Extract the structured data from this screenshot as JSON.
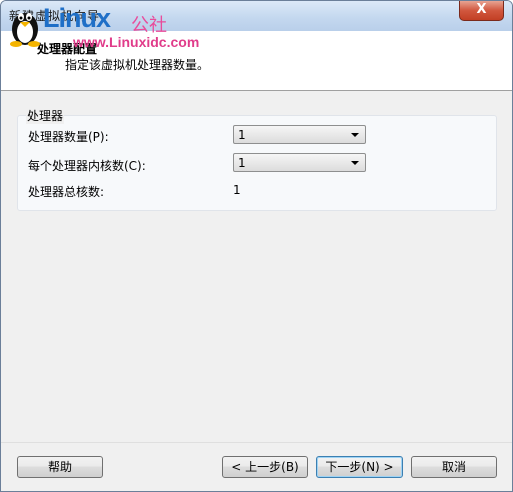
{
  "window": {
    "title": "新建虚拟机向导",
    "close_label": "X"
  },
  "watermark": {
    "brand": "Linux",
    "brand_cn": "公社",
    "url": "www.Linuxidc.com"
  },
  "header": {
    "title": "处理器配置",
    "description": "指定该虚拟机处理器数量。"
  },
  "processor_group": {
    "label": "处理器",
    "processor_count_label": "处理器数量(P):",
    "processor_count_value": "1",
    "cores_per_processor_label": "每个处理器内核数(C):",
    "cores_per_processor_value": "1",
    "total_cores_label": "处理器总核数:",
    "total_cores_value": "1"
  },
  "buttons": {
    "help": "帮助",
    "back": "< 上一步(B)",
    "next": "下一步(N) >",
    "cancel": "取消"
  },
  "colors": {
    "brand_blue": "#1f6fc7",
    "brand_pink": "#e03c8a",
    "close_red": "#d1573e"
  }
}
